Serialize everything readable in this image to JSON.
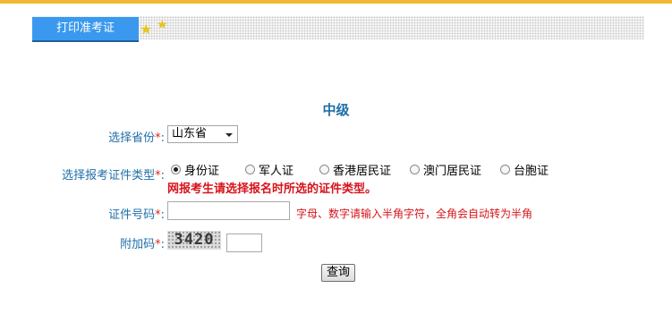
{
  "tab": {
    "label": "打印准考证"
  },
  "form": {
    "title": "中级",
    "province": {
      "label": "选择省份",
      "value": "山东省"
    },
    "id_type": {
      "label": "选择报考证件类型",
      "options": [
        "身份证",
        "军人证",
        "香港居民证",
        "澳门居民证",
        "台胞证"
      ],
      "selected": "身份证",
      "warning": "网报考生请选择报名时所选的证件类型。"
    },
    "id_number": {
      "label": "证件号码",
      "value": "",
      "hint": "字母、数字请输入半角字符，全角会自动转为半角"
    },
    "captcha": {
      "label": "附加码",
      "code": "3420",
      "value": ""
    },
    "required_mark": "*",
    "colon": ":",
    "submit_label": "查询"
  },
  "colors": {
    "accent": "#3a99ee",
    "label": "#1f6fa8",
    "warning": "#d6131a",
    "top_border": "#f2b733"
  }
}
